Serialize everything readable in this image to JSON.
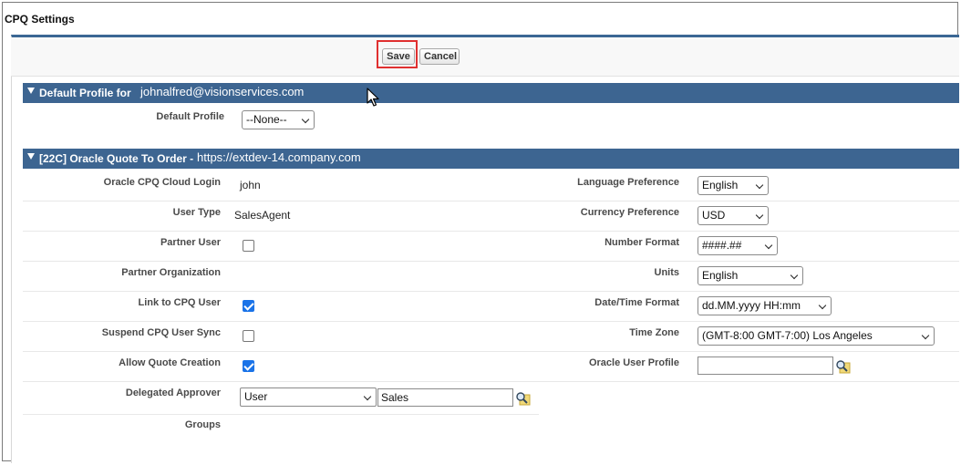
{
  "page": {
    "title": "CPQ Settings"
  },
  "toolbar": {
    "save_label": "Save",
    "cancel_label": "Cancel"
  },
  "default_profile_section": {
    "header_label": "Default Profile for",
    "user_email": "johnalfred@visionservices.com",
    "field_label": "Default Profile",
    "field_value": "--None--"
  },
  "oracle_section": {
    "header_label": "[22C] Oracle Quote To Order -",
    "url": "https://extdev-14.company.com",
    "left": {
      "cloud_login_label": "Oracle CPQ Cloud Login",
      "cloud_login_value": "john",
      "user_type_label": "User Type",
      "user_type_value": "SalesAgent",
      "partner_user_label": "Partner User",
      "partner_user_checked": false,
      "partner_org_label": "Partner Organization",
      "link_cpq_label": "Link to CPQ User",
      "link_cpq_checked": true,
      "suspend_sync_label": "Suspend CPQ User Sync",
      "suspend_sync_checked": false,
      "allow_quote_label": "Allow Quote Creation",
      "allow_quote_checked": true,
      "delegated_label": "Delegated Approver",
      "delegated_type": "User",
      "delegated_value": "Sales",
      "groups_label": "Groups"
    },
    "right": {
      "language_label": "Language Preference",
      "language_value": "English",
      "currency_label": "Currency Preference",
      "currency_value": "USD",
      "number_format_label": "Number Format",
      "number_format_value": "####.##",
      "units_label": "Units",
      "units_value": "English",
      "datetime_label": "Date/Time Format",
      "datetime_value": "dd.MM.yyyy HH:mm",
      "timezone_label": "Time Zone",
      "timezone_value": "(GMT-8:00 GMT-7:00) Los Angeles",
      "user_profile_label": "Oracle User Profile",
      "user_profile_value": ""
    }
  },
  "colors": {
    "section_header": "#3d6591",
    "panel_border": "#3b6794",
    "highlight": "#e03030",
    "checkbox_checked": "#1a73e8"
  },
  "icons": {
    "lookup": "magnifier-lookup-icon",
    "cursor": "mouse-pointer-icon"
  }
}
